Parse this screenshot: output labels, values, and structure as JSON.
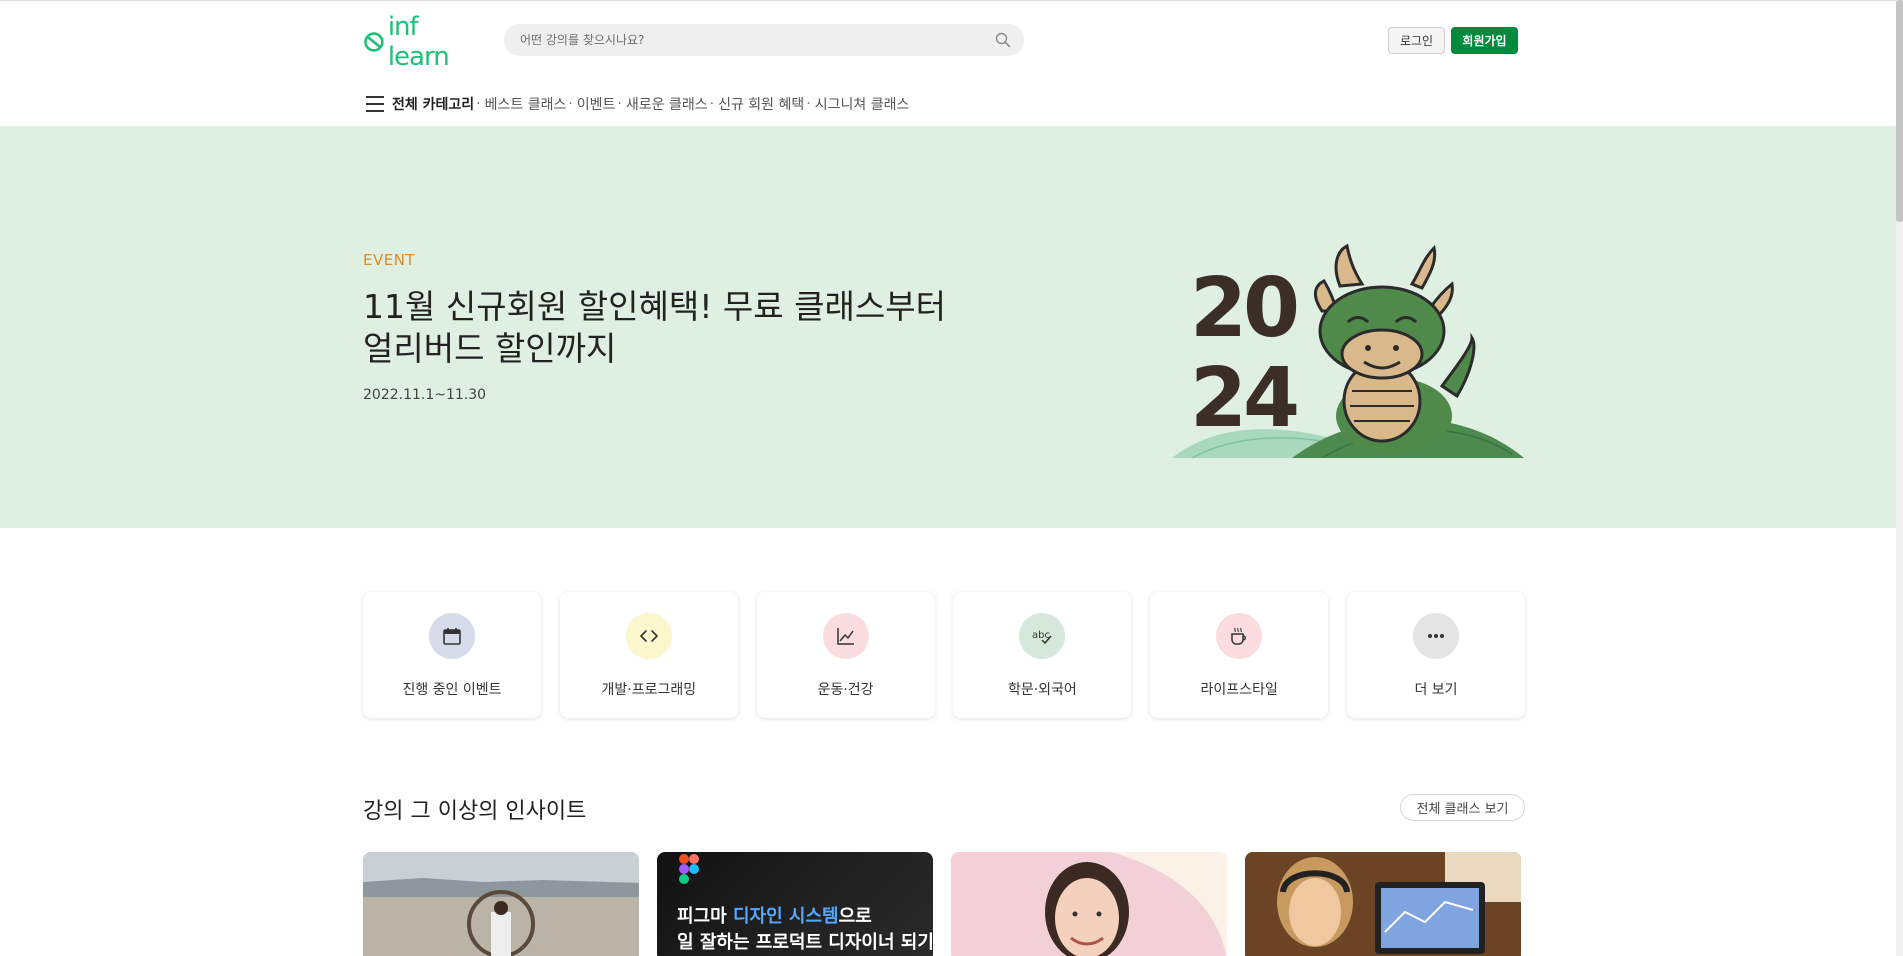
{
  "header": {
    "logo_text": "inf learn",
    "search_placeholder": "어떤 강의를 찾으시나요?",
    "login_label": "로그인",
    "signup_label": "회원가입"
  },
  "nav": {
    "all_categories": "전체 카테고리",
    "items": [
      "베스트 클래스",
      "이벤트",
      "새로운 클래스",
      "신규 회원 혜택",
      "시그니쳐 클래스"
    ],
    "separator": "·"
  },
  "hero": {
    "label": "EVENT",
    "title_line1": "11월 신규회원 할인혜택! 무료 클래스부터",
    "title_line2": "얼리버드 할인까지",
    "date": "2022.11.1~11.30",
    "art_year_top": "20",
    "art_year_bottom": "24"
  },
  "categories": [
    {
      "label": "진행 중인 이벤트",
      "icon": "calendar-icon",
      "color": "#d6dce9"
    },
    {
      "label": "개발·프로그래밍",
      "icon": "code-icon",
      "color": "#fbf6cc"
    },
    {
      "label": "운동·건강",
      "icon": "chart-line-icon",
      "color": "#fbdde0"
    },
    {
      "label": "학문·외국어",
      "icon": "abc-check-icon",
      "color": "#d6e7dc"
    },
    {
      "label": "라이프스타일",
      "icon": "coffee-cup-icon",
      "color": "#fbdde0"
    },
    {
      "label": "더 보기",
      "icon": "more-dots-icon",
      "color": "#e4e4e4"
    }
  ],
  "section": {
    "title": "강의 그 이상의 인사이트",
    "view_all": "전체 클래스 보기"
  },
  "cards": [
    {
      "label": "beach-photo-thumbnail"
    },
    {
      "text_part1": "피그마 ",
      "text_highlight": "디자인 시스템",
      "text_part2": "으로",
      "text_line2": "일 잘하는 프로덕트 디자이너 되기"
    },
    {
      "label": "instructor-portrait-thumbnail"
    },
    {
      "label": "laptop-study-thumbnail"
    }
  ],
  "colors": {
    "brand": "#1dc078",
    "signup": "#008a3e",
    "hero_bg": "#dfefe2",
    "event_label": "#e08a20"
  }
}
